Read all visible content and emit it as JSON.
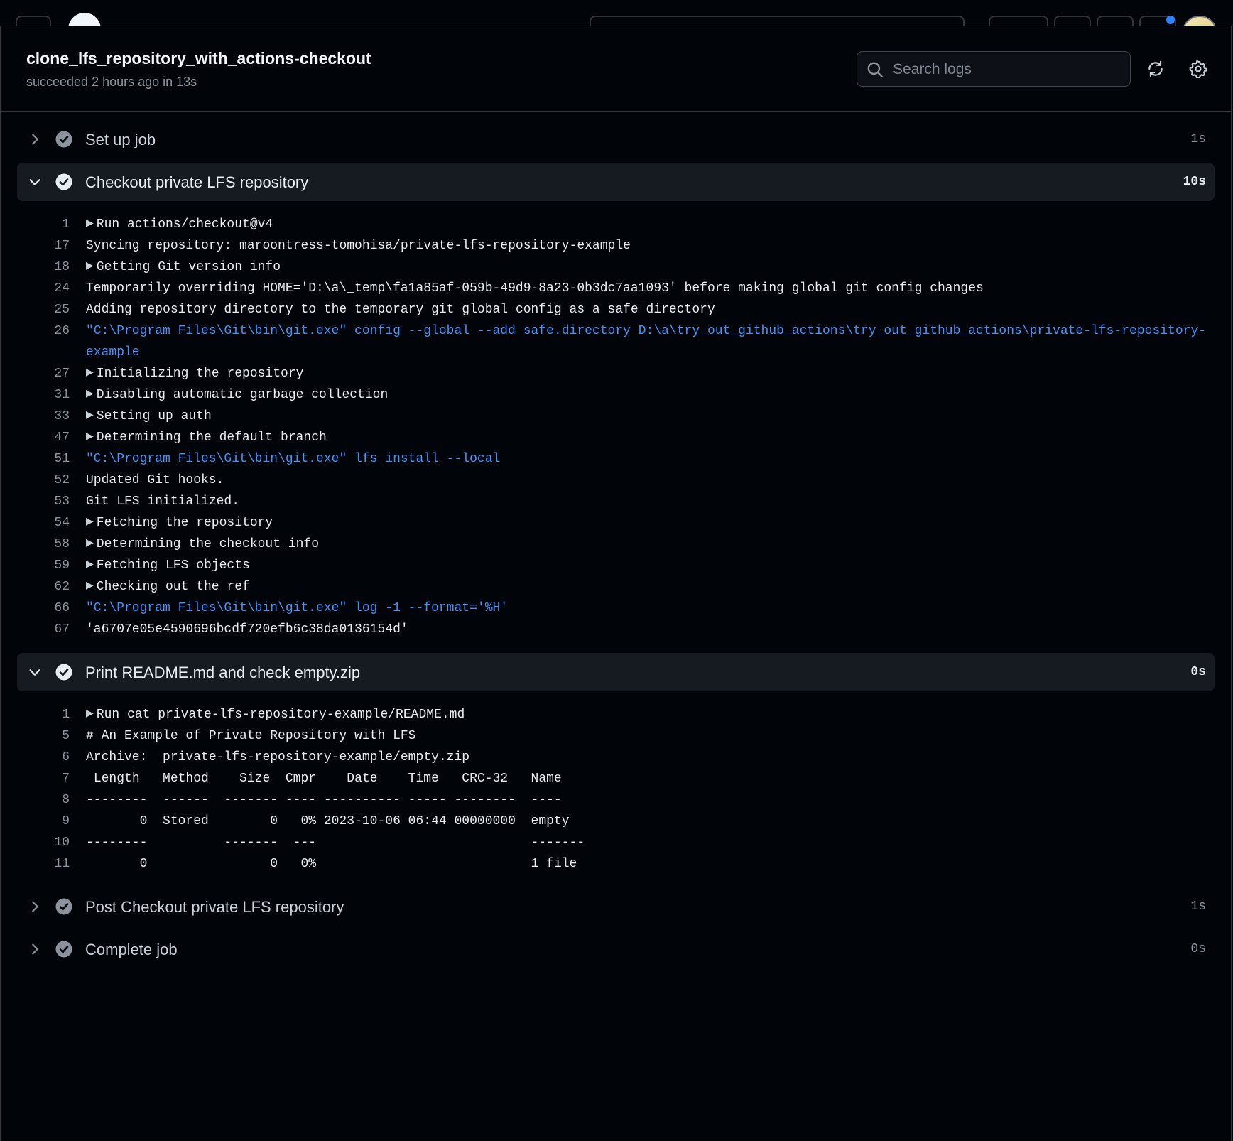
{
  "job": {
    "title": "clone_lfs_repository_with_actions-checkout",
    "status": "succeeded 2 hours ago in 13s"
  },
  "search": {
    "placeholder": "Search logs"
  },
  "colors": {
    "background": "#010409",
    "accent": "#4493f8",
    "success": "#8b949e"
  },
  "steps": [
    {
      "label": "Set up job",
      "duration": "1s",
      "expanded": false
    },
    {
      "label": "Checkout private LFS repository",
      "duration": "10s",
      "expanded": true
    },
    {
      "label": "Print README.md and check empty.zip",
      "duration": "0s",
      "expanded": true
    },
    {
      "label": "Post Checkout private LFS repository",
      "duration": "1s",
      "expanded": false
    },
    {
      "label": "Complete job",
      "duration": "0s",
      "expanded": false
    }
  ],
  "checkout_log": [
    {
      "n": "1",
      "text": "Run actions/checkout@v4",
      "group": true
    },
    {
      "n": "17",
      "text": "Syncing repository: maroontress-tomohisa/private-lfs-repository-example"
    },
    {
      "n": "18",
      "text": "Getting Git version info",
      "group": true
    },
    {
      "n": "24",
      "text": "Temporarily overriding HOME='D:\\a\\_temp\\fa1a85af-059b-49d9-8a23-0b3dc7aa1093' before making global git config changes"
    },
    {
      "n": "25",
      "text": "Adding repository directory to the temporary git global config as a safe directory"
    },
    {
      "n": "26",
      "text": "\"C:\\Program Files\\Git\\bin\\git.exe\" config --global --add safe.directory D:\\a\\try_out_github_actions\\try_out_github_actions\\private-lfs-repository-example",
      "cmd": true,
      "wrap": true
    },
    {
      "n": "27",
      "text": "Initializing the repository",
      "group": true
    },
    {
      "n": "31",
      "text": "Disabling automatic garbage collection",
      "group": true
    },
    {
      "n": "33",
      "text": "Setting up auth",
      "group": true
    },
    {
      "n": "47",
      "text": "Determining the default branch",
      "group": true
    },
    {
      "n": "51",
      "text": "\"C:\\Program Files\\Git\\bin\\git.exe\" lfs install --local",
      "cmd": true
    },
    {
      "n": "52",
      "text": "Updated Git hooks."
    },
    {
      "n": "53",
      "text": "Git LFS initialized."
    },
    {
      "n": "54",
      "text": "Fetching the repository",
      "group": true
    },
    {
      "n": "58",
      "text": "Determining the checkout info",
      "group": true
    },
    {
      "n": "59",
      "text": "Fetching LFS objects",
      "group": true
    },
    {
      "n": "62",
      "text": "Checking out the ref",
      "group": true
    },
    {
      "n": "66",
      "text": "\"C:\\Program Files\\Git\\bin\\git.exe\" log -1 --format='%H'",
      "cmd": true
    },
    {
      "n": "67",
      "text": "'a6707e05e4590696bcdf720efb6c38da0136154d'"
    }
  ],
  "print_log": [
    {
      "n": "1",
      "text": "Run cat private-lfs-repository-example/README.md",
      "group": true
    },
    {
      "n": "5",
      "text": "# An Example of Private Repository with LFS"
    },
    {
      "n": "6",
      "text": "Archive:  private-lfs-repository-example/empty.zip"
    },
    {
      "n": "7",
      "text": " Length   Method    Size  Cmpr    Date    Time   CRC-32   Name"
    },
    {
      "n": "8",
      "text": "--------  ------  ------- ---- ---------- ----- --------  ----"
    },
    {
      "n": "9",
      "text": "       0  Stored        0   0% 2023-10-06 06:44 00000000  empty"
    },
    {
      "n": "10",
      "text": "--------          -------  ---                            -------"
    },
    {
      "n": "11",
      "text": "       0                0   0%                            1 file"
    }
  ]
}
